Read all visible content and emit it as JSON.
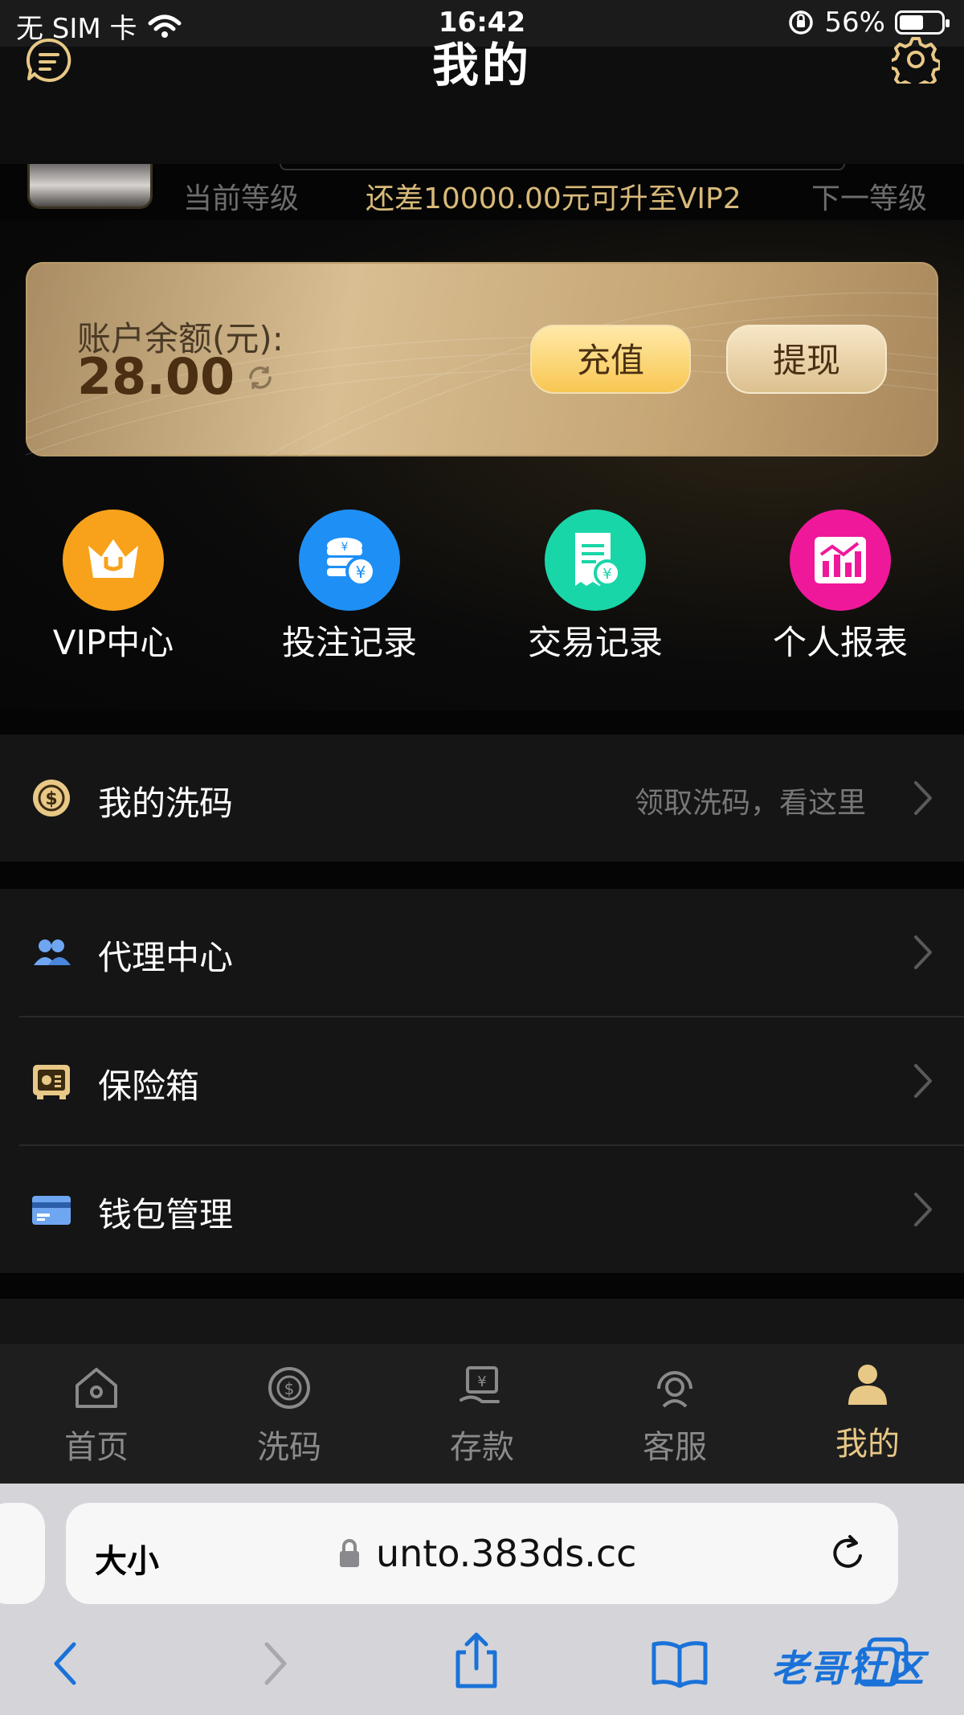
{
  "status_bar": {
    "carrier": "无 SIM 卡",
    "time": "16:42",
    "battery": "56%",
    "battery_level": 0.56
  },
  "header": {
    "title": "我的"
  },
  "profile": {
    "current_level": "当前等级",
    "upgrade_hint": "还差10000.00元可升至VIP2",
    "next_level": "下一等级"
  },
  "balance": {
    "label": "账户余额(元):",
    "amount": "28.00",
    "recharge": "充值",
    "withdraw": "提现"
  },
  "quick_links": [
    {
      "label": "VIP中心",
      "icon": "crown-icon",
      "color": "#F8A21B"
    },
    {
      "label": "投注记录",
      "icon": "coins-icon",
      "color": "#1E90F5"
    },
    {
      "label": "交易记录",
      "icon": "receipt-icon",
      "color": "#19D6A8"
    },
    {
      "label": "个人报表",
      "icon": "chart-icon",
      "color": "#F0189A"
    }
  ],
  "menu": {
    "rebate": {
      "label": "我的洗码",
      "hint": "领取洗码，看这里"
    },
    "agent": {
      "label": "代理中心"
    },
    "safe": {
      "label": "保险箱"
    },
    "wallet": {
      "label": "钱包管理"
    }
  },
  "tabbar": [
    {
      "label": "首页",
      "icon": "home-icon"
    },
    {
      "label": "洗码",
      "icon": "rebate-coin-icon"
    },
    {
      "label": "存款",
      "icon": "deposit-icon"
    },
    {
      "label": "客服",
      "icon": "support-icon"
    },
    {
      "label": "我的",
      "icon": "user-icon",
      "active": true
    }
  ],
  "browser": {
    "text_size": "大小",
    "url": "unto.383ds.cc"
  },
  "watermark": "老哥社区",
  "colors": {
    "gold": "#E8C886",
    "accent_text": "#D8B979"
  }
}
